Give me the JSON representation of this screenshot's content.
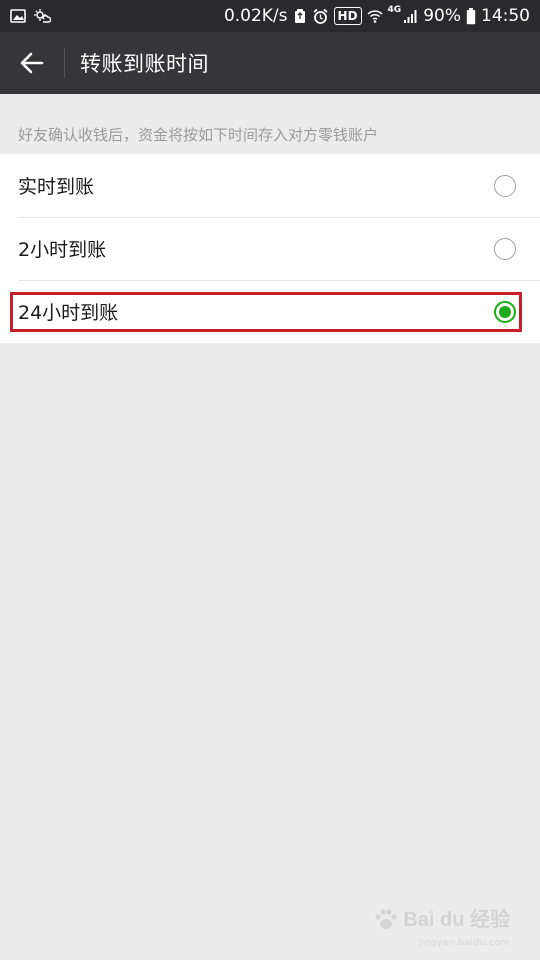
{
  "status_bar": {
    "net_speed": "0.02K/s",
    "hd_badge": "HD",
    "network_type": "4G",
    "battery": "90%",
    "time": "14:50",
    "icons": [
      "image-icon",
      "weather-icon",
      "recycle-icon",
      "alarm-icon",
      "wifi-icon",
      "signal-icon",
      "battery-icon"
    ]
  },
  "app_bar": {
    "back_icon": "arrow-left-icon",
    "title": "转账到账时间"
  },
  "hint_text": "好友确认收钱后，资金将按如下时间存入对方零钱账户",
  "options": [
    {
      "label": "实时到账",
      "selected": false
    },
    {
      "label": "2小时到账",
      "selected": false
    },
    {
      "label": "24小时到账",
      "selected": true
    }
  ],
  "watermark": {
    "text": "Bai du 经验",
    "subtext": "jingyan.baidu.com"
  },
  "colors": {
    "accent": "#1aad19",
    "highlight": "#c8202a",
    "app_bar_bg": "#363638",
    "status_bar_bg": "#2a2a2c",
    "page_bg": "#ececec"
  }
}
